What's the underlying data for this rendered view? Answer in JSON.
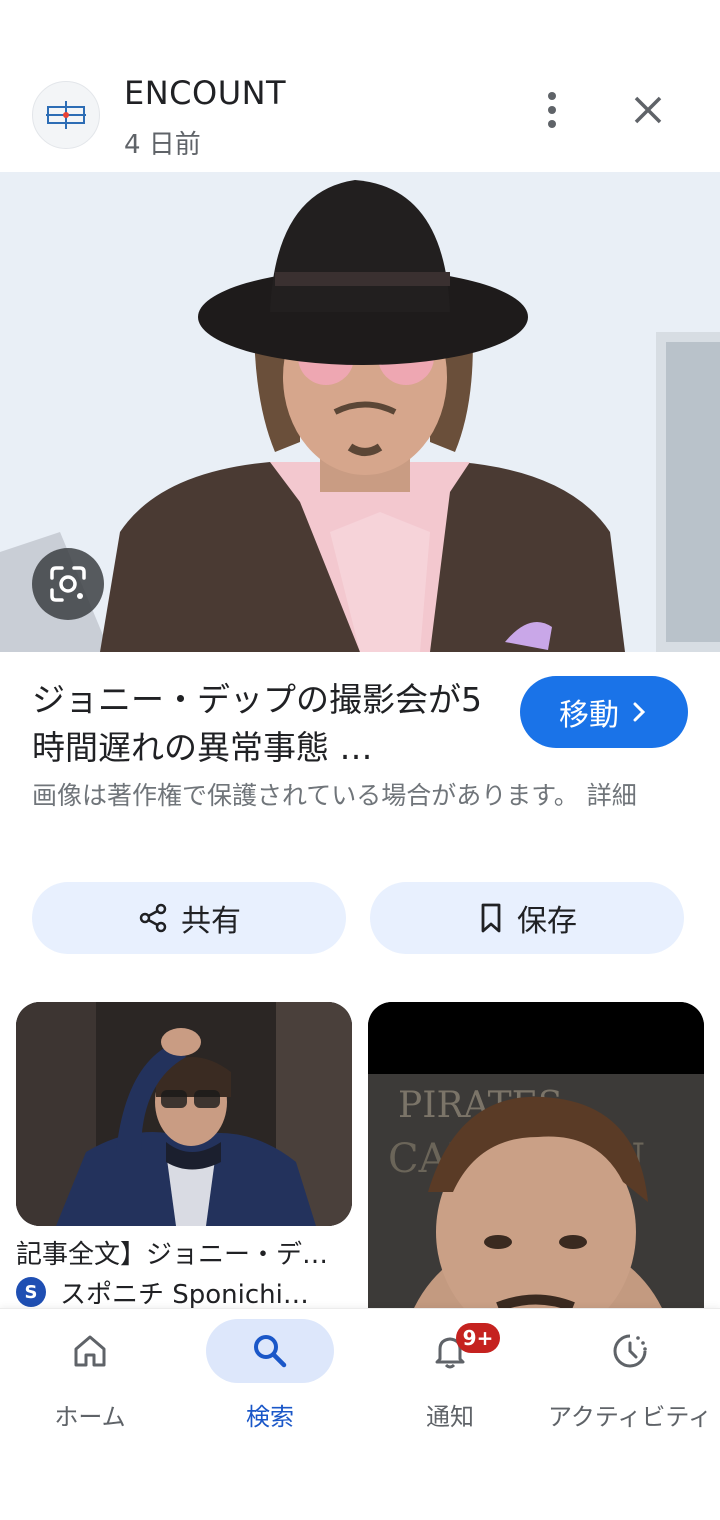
{
  "header": {
    "source_name": "ENCOUNT",
    "date": "4 日前",
    "more_icon": "more-vert-icon",
    "close_icon": "close-icon"
  },
  "main": {
    "title": "ジョニー・デップの撮影会が5時間遅れの異常事態 …",
    "move_button": "移動",
    "copyright_notice": "画像は著作権で保護されている場合があります。 詳細",
    "share_button": "共有",
    "save_button": "保存",
    "lens_icon": "google-lens-icon"
  },
  "related": [
    {
      "title": "記事全文】ジョニー・デ…",
      "source": "スポニチ Sponichi…",
      "source_logo": "S"
    }
  ],
  "bottom_nav": {
    "items": [
      {
        "label": "ホーム",
        "icon": "home-icon",
        "active": false
      },
      {
        "label": "検索",
        "icon": "search-icon",
        "active": true
      },
      {
        "label": "通知",
        "icon": "bell-icon",
        "active": false,
        "badge": "9+"
      },
      {
        "label": "アクティビティ",
        "icon": "activity-icon",
        "active": false
      }
    ]
  },
  "colors": {
    "accent": "#1a73e8",
    "chip_bg": "#e8f0fe",
    "badge": "#c5221f",
    "nav_active_bg": "#dde7fb"
  }
}
